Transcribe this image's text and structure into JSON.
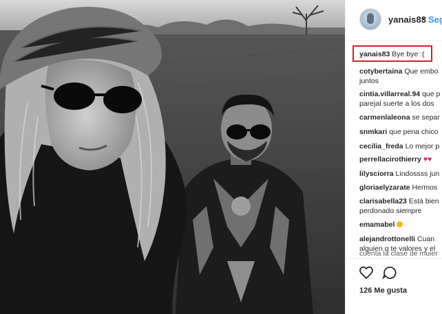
{
  "post": {
    "username": "yanais83",
    "separator": "•",
    "follow_label": "Seg",
    "caption_user": "yanais83",
    "caption_text": "Bye bye :(",
    "likes": "126 Me gusta"
  },
  "comments": [
    {
      "user": "cotybertaina",
      "text": "Que embo",
      "text2": "juntos"
    },
    {
      "user": "cintia.villarreal.94",
      "text": "que p",
      "text2": "parejal suerte a los dos"
    },
    {
      "user": "carmenlaleona",
      "text": "se separ",
      "text2": ""
    },
    {
      "user": "snmkari",
      "text": "que pena chico",
      "text2": ""
    },
    {
      "user": "cecilia_freda",
      "text": "Lo mejor p",
      "text2": ""
    },
    {
      "user": "perrellacirothierry",
      "text": "♥♥",
      "text2": ""
    },
    {
      "user": "lilysciorra",
      "text": "Lindossss jun",
      "text2": ""
    },
    {
      "user": "gloriaelyzarate",
      "text": "Hermos",
      "text2": ""
    },
    {
      "user": "clarisabella23",
      "text": "Está bien",
      "text2": "perdonado siempre"
    },
    {
      "user": "emamabel",
      "text": "",
      "text2": ""
    },
    {
      "user": "alejandrottonelli",
      "text": "Cuan",
      "text2": "alguien q te valores y el"
    },
    {
      "user": "",
      "text": "",
      "text2": "cuenta la clase de mujer"
    }
  ],
  "icons": [
    "heart-outline-icon",
    "comment-bubble-icon"
  ],
  "colors": {
    "highlight": "#d6202b",
    "follow": "#3897f0",
    "text": "#262626"
  }
}
